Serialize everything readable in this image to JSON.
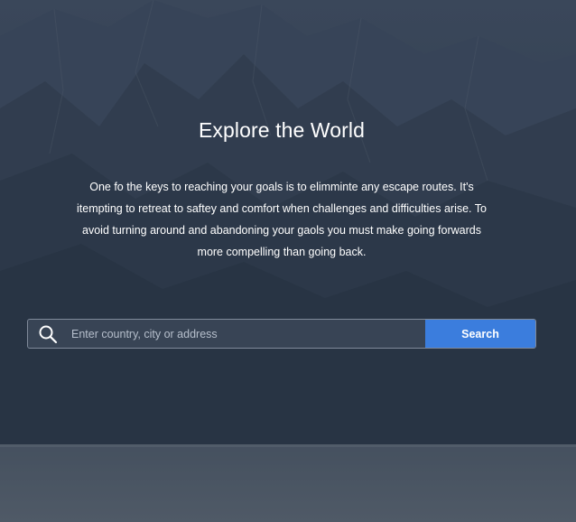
{
  "hero": {
    "title": "Explore the World",
    "description": "One fo the keys to reaching your goals is to elimminte any escape routes. It's itempting to retreat to saftey and comfort when challenges and difficulties arise. To avoid turning around and abandoning your gaols you must make going forwards more compelling than going back."
  },
  "search": {
    "placeholder": "Enter country, city or address",
    "value": "",
    "button_label": "Search",
    "icon": "search-icon"
  },
  "colors": {
    "accent": "#3b7ddd",
    "text": "#ffffff",
    "background": "#34404f"
  }
}
